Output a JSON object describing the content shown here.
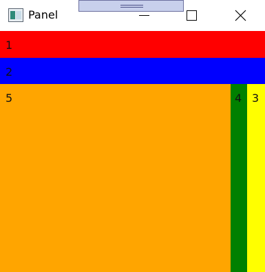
{
  "window": {
    "title": "Panel"
  },
  "panels": [
    {
      "label": "1",
      "color": "#ff0000"
    },
    {
      "label": "2",
      "color": "#0000ff"
    },
    {
      "label": "5",
      "color": "#ffa500"
    },
    {
      "label": "4",
      "color": "#008000"
    },
    {
      "label": "3",
      "color": "#ffff00"
    }
  ],
  "icons": {
    "app": "window-app-icon",
    "minimize": "minimize-icon",
    "maximize": "maximize-icon",
    "close": "close-icon",
    "drag": "drag-handle-icon"
  }
}
